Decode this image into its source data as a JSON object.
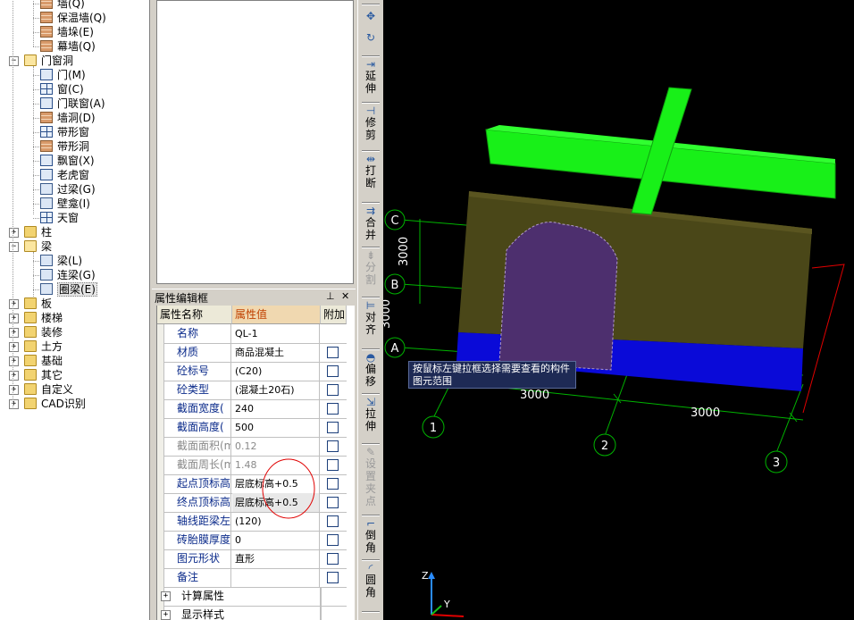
{
  "tree": {
    "nodes": [
      {
        "label": "墙(Q)",
        "level": 2,
        "icon": "wall-icon"
      },
      {
        "label": "保温墙(Q)",
        "level": 2,
        "icon": "insulation-wall-icon"
      },
      {
        "label": "墙垛(E)",
        "level": 2,
        "icon": "wall-pier-icon"
      },
      {
        "label": "幕墙(Q)",
        "level": 2,
        "icon": "curtain-wall-icon"
      },
      {
        "label": "门窗洞",
        "level": 1,
        "icon": "folder-open-icon",
        "expander": "−"
      },
      {
        "label": "门(M)",
        "level": 2,
        "icon": "door-icon"
      },
      {
        "label": "窗(C)",
        "level": 2,
        "icon": "window-icon"
      },
      {
        "label": "门联窗(A)",
        "level": 2,
        "icon": "door-window-icon"
      },
      {
        "label": "墙洞(D)",
        "level": 2,
        "icon": "wall-hole-icon"
      },
      {
        "label": "带形窗",
        "level": 2,
        "icon": "strip-window-icon"
      },
      {
        "label": "带形洞",
        "level": 2,
        "icon": "strip-hole-icon"
      },
      {
        "label": "飘窗(X)",
        "level": 2,
        "icon": "bay-window-icon"
      },
      {
        "label": "老虎窗",
        "level": 2,
        "icon": "dormer-window-icon"
      },
      {
        "label": "过梁(G)",
        "level": 2,
        "icon": "lintel-icon"
      },
      {
        "label": "壁龛(I)",
        "level": 2,
        "icon": "niche-icon"
      },
      {
        "label": "天窗",
        "level": 2,
        "icon": "skylight-icon"
      },
      {
        "label": "柱",
        "level": 1,
        "icon": "folder-icon",
        "expander": "+"
      },
      {
        "label": "梁",
        "level": 1,
        "icon": "folder-open-icon",
        "expander": "−"
      },
      {
        "label": "梁(L)",
        "level": 2,
        "icon": "beam-icon"
      },
      {
        "label": "连梁(G)",
        "level": 2,
        "icon": "coupling-beam-icon"
      },
      {
        "label": "圈梁(E)",
        "level": 2,
        "icon": "ring-beam-icon",
        "selected": true
      },
      {
        "label": "板",
        "level": 1,
        "icon": "folder-icon",
        "expander": "+"
      },
      {
        "label": "楼梯",
        "level": 1,
        "icon": "folder-icon",
        "expander": "+"
      },
      {
        "label": "装修",
        "level": 1,
        "icon": "folder-icon",
        "expander": "+"
      },
      {
        "label": "土方",
        "level": 1,
        "icon": "folder-icon",
        "expander": "+"
      },
      {
        "label": "基础",
        "level": 1,
        "icon": "folder-icon",
        "expander": "+"
      },
      {
        "label": "其它",
        "level": 1,
        "icon": "folder-icon",
        "expander": "+"
      },
      {
        "label": "自定义",
        "level": 1,
        "icon": "folder-icon",
        "expander": "+"
      },
      {
        "label": "CAD识别",
        "level": 1,
        "icon": "folder-icon",
        "expander": "+"
      }
    ]
  },
  "props": {
    "title": "属性编辑框",
    "pin_icon": "pin-icon",
    "close_glyph": "✕",
    "headers": {
      "name": "属性名称",
      "value": "属性值",
      "extra": "附加"
    },
    "rows": [
      {
        "name": "名称",
        "value": "QL-1",
        "checkbox": false
      },
      {
        "name": "材质",
        "value": "商品混凝土",
        "checkbox": true
      },
      {
        "name": "砼标号",
        "value": "(C20)",
        "checkbox": true
      },
      {
        "name": "砼类型",
        "value": "(混凝土20石)",
        "checkbox": true
      },
      {
        "name": "截面宽度(",
        "value": "240",
        "checkbox": true
      },
      {
        "name": "截面高度(",
        "value": "500",
        "checkbox": true
      },
      {
        "name": "截面面积(m",
        "value": "0.12",
        "checkbox": true,
        "readonly": true
      },
      {
        "name": "截面周长(m",
        "value": "1.48",
        "checkbox": true,
        "readonly": true
      },
      {
        "name": "起点顶标高",
        "value": "层底标高+0.5",
        "checkbox": true
      },
      {
        "name": "终点顶标高",
        "value": "层底标高+0.5",
        "checkbox": true,
        "selected": true
      },
      {
        "name": "轴线距梁左",
        "value": "(120)",
        "checkbox": true
      },
      {
        "name": "砖胎膜厚度",
        "value": "0",
        "checkbox": true
      },
      {
        "name": "图元形状",
        "value": "直形",
        "checkbox": true
      },
      {
        "name": "备注",
        "value": "",
        "checkbox": true
      }
    ],
    "groups": [
      "计算属性",
      "显示样式"
    ]
  },
  "toolbar": {
    "buttons": [
      {
        "icon": "move-icon",
        "glyph": "✥",
        "label": ""
      },
      {
        "icon": "rotate-icon",
        "glyph": "↻",
        "label": ""
      },
      {
        "icon": "extend-icon",
        "glyph": "⇥",
        "label": "延伸"
      },
      {
        "icon": "trim-icon",
        "glyph": "⊣",
        "label": "修剪"
      },
      {
        "icon": "break-icon",
        "glyph": "⇹",
        "label": "打断"
      },
      {
        "icon": "merge-icon",
        "glyph": "⇉",
        "label": "合并"
      },
      {
        "icon": "split-icon",
        "glyph": "⇟",
        "label": "分割",
        "disabled": true
      },
      {
        "icon": "align-icon",
        "glyph": "⊨",
        "label": "对齐"
      },
      {
        "icon": "offset-icon",
        "glyph": "◓",
        "label": "偏移"
      },
      {
        "icon": "stretch-icon",
        "glyph": "⇲",
        "label": "拉伸"
      },
      {
        "icon": "set-anchor-icon",
        "glyph": "✎",
        "label": "设置夹点",
        "disabled": true
      },
      {
        "icon": "chamfer-icon",
        "glyph": "⌐",
        "label": "倒角"
      },
      {
        "icon": "fillet-icon",
        "glyph": "◜",
        "label": "圆角"
      }
    ]
  },
  "viewport": {
    "tooltip": "按鼠标左键拉框选择需要查看的构件图元范围",
    "axis_labels": [
      "C",
      "B",
      "A",
      "1",
      "2",
      "3"
    ],
    "dimensions": [
      "3000",
      "3000",
      "3000",
      "3000"
    ],
    "axis_triad": [
      "Z",
      "Y"
    ],
    "colors": {
      "background": "#000000",
      "grid": "#00b400",
      "green_beam": "#18f018",
      "wall": "#4a4718",
      "opening": "#4d2f6e",
      "ring_beam": "#0a0ad8",
      "annotation": "#e00000"
    }
  }
}
